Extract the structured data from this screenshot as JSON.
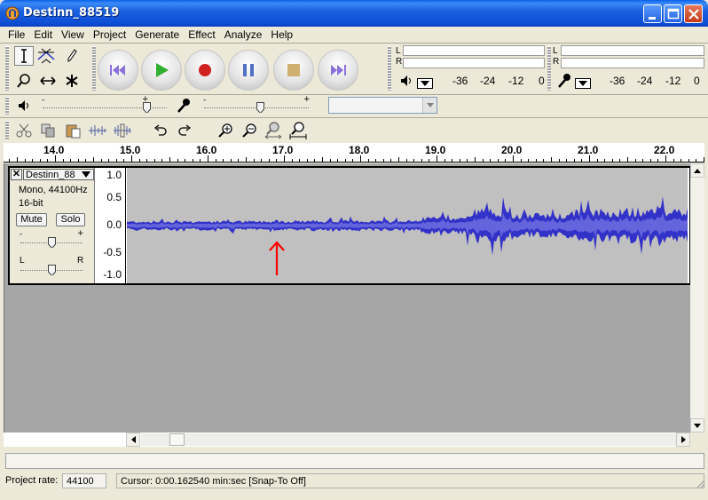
{
  "window": {
    "title": "Destinn_88519",
    "controls": [
      "minimize",
      "maximize",
      "close"
    ]
  },
  "menu": [
    "File",
    "Edit",
    "View",
    "Project",
    "Generate",
    "Effect",
    "Analyze",
    "Help"
  ],
  "tools": {
    "row1": [
      "selection-tool-icon",
      "envelope-tool-icon",
      "draw-tool-icon"
    ],
    "row2": [
      "zoom-tool-icon",
      "time-shift-tool-icon",
      "multi-tool-icon"
    ]
  },
  "transport": [
    "skip-to-start-icon",
    "play-icon",
    "record-icon",
    "pause-icon",
    "stop-icon",
    "skip-to-end-icon"
  ],
  "meters": {
    "playback": {
      "L": "L",
      "R": "R",
      "scale": [
        "-36",
        "-24",
        "-12",
        "0"
      ]
    },
    "record": {
      "L": "L",
      "R": "R",
      "scale": [
        "-36",
        "-24",
        "-12",
        "0"
      ]
    }
  },
  "mixer": {
    "output_volume": 0.7,
    "input_volume": 0.5
  },
  "ruler": {
    "labels": [
      "14.0",
      "15.0",
      "16.0",
      "17.0",
      "18.0",
      "19.0",
      "20.0",
      "21.0",
      "22.0"
    ]
  },
  "track": {
    "name": "Destinn_88",
    "info_line1": "Mono, 44100Hz",
    "info_line2": "16-bit",
    "mute_label": "Mute",
    "solo_label": "Solo",
    "gain_minus": "-",
    "gain_plus": "+",
    "pan_left": "L",
    "pan_right": "R",
    "gain_value": 0.5,
    "pan_value": 0.5,
    "scale": [
      "1.0",
      "0.5",
      "0.0",
      "-0.5",
      "-1.0"
    ]
  },
  "annotation": {
    "arrow_color": "#ff0000"
  },
  "status": {
    "project_rate_label": "Project rate:",
    "project_rate_value": "44100",
    "cursor_text": "Cursor: 0:00.162540 min:sec   [Snap-To Off]"
  },
  "colors": {
    "waveform": "#3232c8",
    "waveform_rms": "#6464dc",
    "track_bg": "#c0c0c0",
    "titlebar": "#0a5fe8"
  }
}
